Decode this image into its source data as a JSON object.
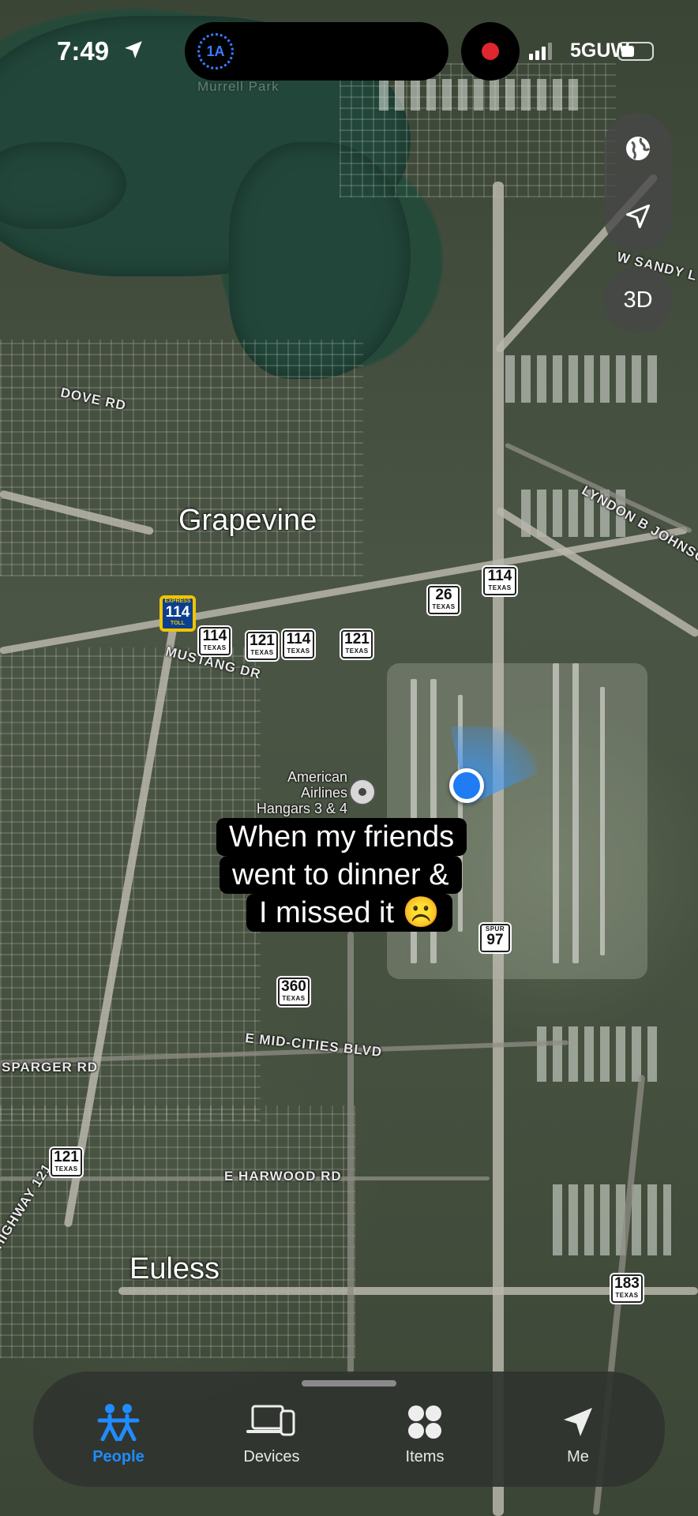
{
  "status_bar": {
    "time": "7:49",
    "island_badge": "1A",
    "network": "5GUW"
  },
  "map": {
    "cities": [
      "Grapevine",
      "Euless"
    ],
    "streets": [
      "DOVE RD",
      "MUSTANG DR",
      "E MID-CITIES BLVD",
      "E HARWOOD RD",
      "SPARGER RD",
      "HIGHWAY 121",
      "LYNDON B JOHNSO",
      "W SANDY L",
      "Murrell Park"
    ],
    "poi": {
      "name_lines": [
        "American",
        "Airlines",
        "Hangars 3 & 4"
      ]
    },
    "shields": [
      {
        "num": "114",
        "sub": "TEXAS"
      },
      {
        "num": "26",
        "sub": "TEXAS"
      },
      {
        "num": "114",
        "sub": "TEXAS"
      },
      {
        "num": "121",
        "sub": "TEXAS"
      },
      {
        "num": "114",
        "sub": "TEXAS"
      },
      {
        "num": "121",
        "sub": "TEXAS"
      },
      {
        "num": "97",
        "sub": "SPUR"
      },
      {
        "num": "360",
        "sub": "TEXAS"
      },
      {
        "num": "121",
        "sub": "TEXAS"
      },
      {
        "num": "183",
        "sub": "TEXAS"
      }
    ],
    "toll_shield": {
      "top": "EXPRESS",
      "num": "114",
      "bottom": "TOLL"
    }
  },
  "controls": {
    "globe_icon": "globe-icon",
    "locate_icon": "location-arrow-icon",
    "three_d_label": "3D"
  },
  "caption": {
    "lines": [
      "When my friends",
      "went to dinner &",
      "I missed it ☹️"
    ]
  },
  "tabbar": {
    "tabs": [
      {
        "label": "People",
        "icon": "people-icon",
        "active": true
      },
      {
        "label": "Devices",
        "icon": "devices-icon",
        "active": false
      },
      {
        "label": "Items",
        "icon": "items-icon",
        "active": false
      },
      {
        "label": "Me",
        "icon": "me-arrow-icon",
        "active": false
      }
    ],
    "accent_color": "#1f8cff"
  }
}
